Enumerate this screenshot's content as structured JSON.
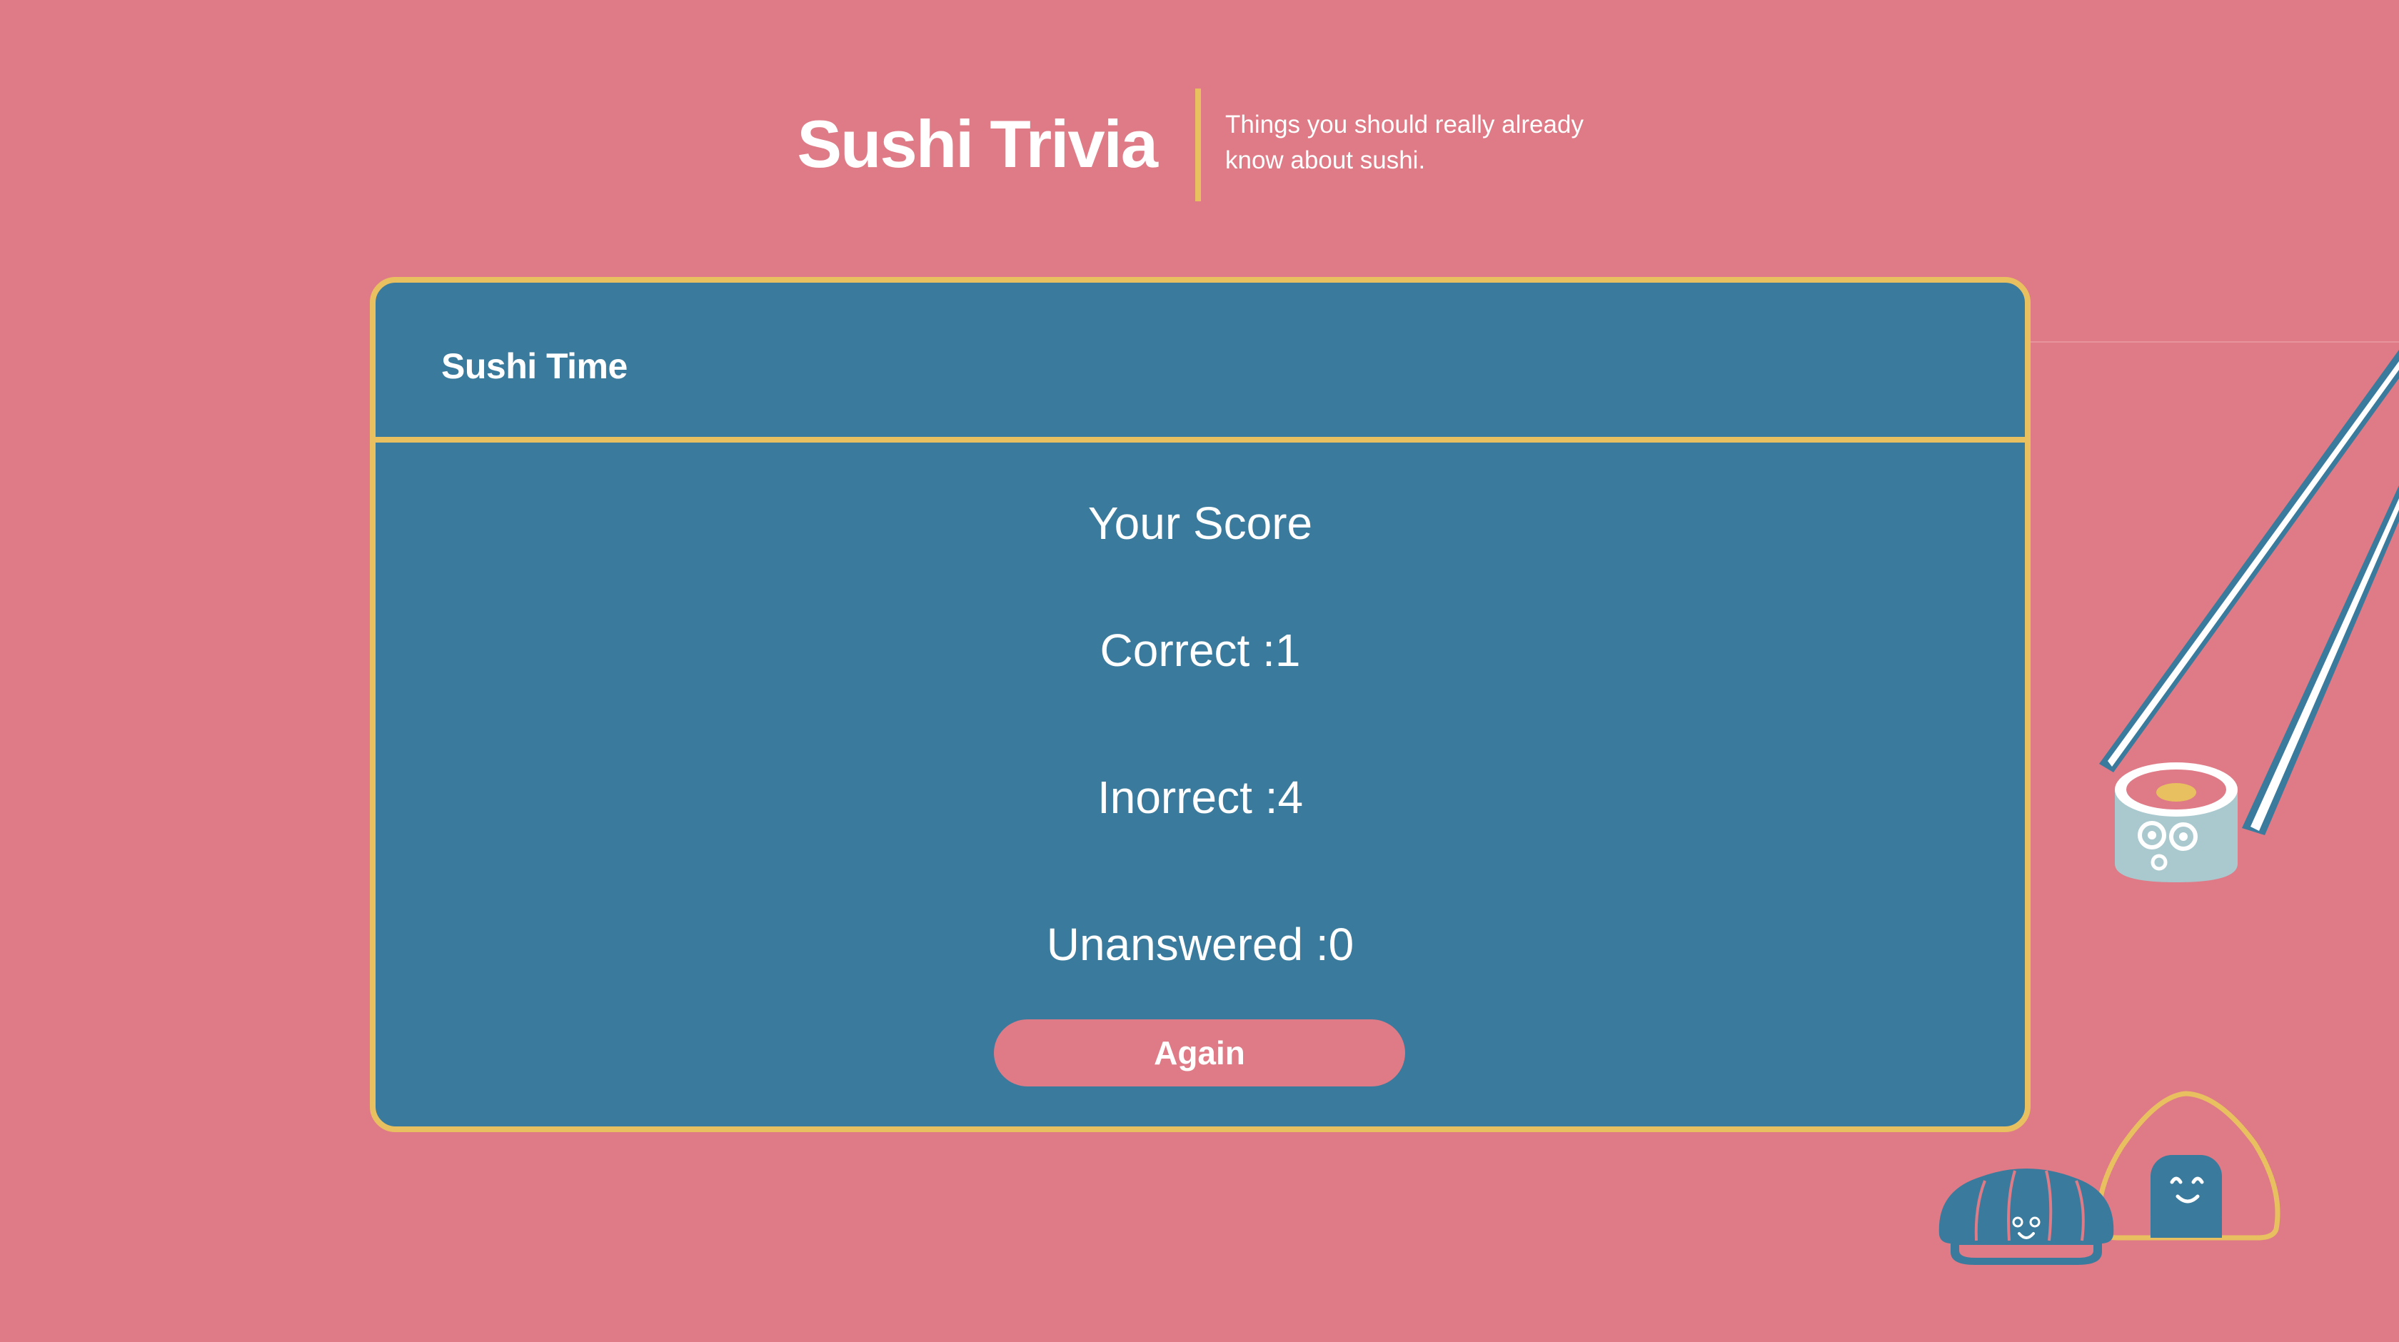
{
  "header": {
    "title": "Sushi Trivia",
    "tagline_line1": "Things you should really already",
    "tagline_line2": "know about sushi."
  },
  "card": {
    "title": "Sushi Time",
    "score_heading": "Your Score",
    "correct_text": "Correct :1",
    "incorrect_text": "Inorrect :4",
    "unanswered_text": "Unanswered :0",
    "again_label": "Again"
  },
  "colors": {
    "background": "#de7b86",
    "card": "#3a7a9c",
    "accent": "#e9c05f",
    "text": "#ffffff"
  },
  "icons": [
    "chopsticks-icon",
    "sushi-roll-icon",
    "nigiri-icon",
    "onigiri-icon"
  ]
}
